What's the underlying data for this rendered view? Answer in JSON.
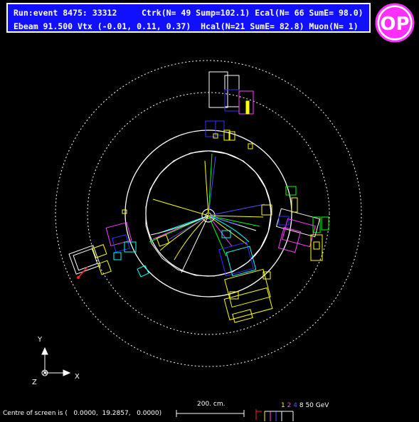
{
  "header": {
    "line1": "Run:event 8475: 33312     Ctrk(N= 49 Sump=102.1) Ecal(N= 66 SumE= 98.0)",
    "line2": "Ebeam 91.500 Vtx (-0.01, 0.11, 0.37)  Hcal(N=21 SumE= 82.8) Muon(N= 1)"
  },
  "logo": {
    "text": "OPAL",
    "colors": {
      "ring": "#ff30ff",
      "letters": "#2020ff"
    }
  },
  "axes": {
    "y": "Y",
    "x": "X",
    "z": "Z"
  },
  "scale_bar": {
    "label": "200. cm."
  },
  "energy_legend": {
    "items": [
      {
        "text": "1",
        "color": "#ffff00"
      },
      {
        "text": "2",
        "color": "#ff40ff"
      },
      {
        "text": "4",
        "color": "#5050ff"
      },
      {
        "text": "8",
        "color": "#ffffff"
      },
      {
        "text": "50 GeV",
        "color": "#ffffff"
      }
    ]
  },
  "footer": {
    "centre_text": "Centre of screen is (   0.0000,  19.2857,   0.0000)"
  },
  "colors": {
    "background": "#000000",
    "tracks": [
      "#ffff00",
      "#00ff00",
      "#5050ff",
      "#00ffff",
      "#ff40ff",
      "#ffffff"
    ],
    "calorimeter_yellow": "#ffff00",
    "calorimeter_blue": "#3030ff",
    "calorimeter_magenta": "#ff40ff",
    "calorimeter_cyan": "#00e0e0",
    "muon_red": "#ff2020"
  }
}
